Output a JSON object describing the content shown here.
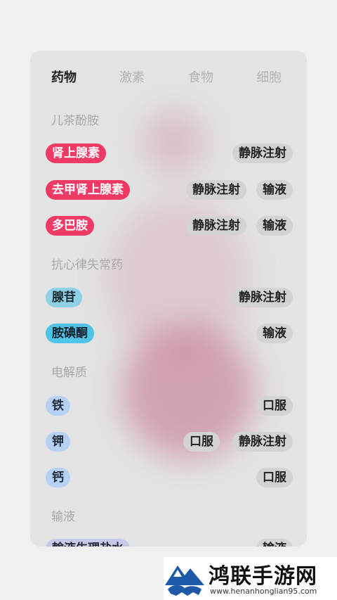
{
  "tabs": [
    "药物",
    "激素",
    "食物",
    "细胞"
  ],
  "sections": {
    "s1": "儿茶酚胺",
    "s2": "抗心律失常药",
    "s3": "电解质",
    "s4": "输液"
  },
  "rows": [
    {
      "name": "肾上腺素",
      "tags": [
        "静脉注射"
      ]
    },
    {
      "name": "去甲肾上腺素",
      "tags": [
        "静脉注射",
        "输液"
      ]
    },
    {
      "name": "多巴胺",
      "tags": [
        "静脉注射",
        "输液"
      ]
    },
    {
      "name": "腺苷",
      "tags": [
        "静脉注射"
      ]
    },
    {
      "name": "胺碘酮",
      "tags": [
        "输液"
      ]
    },
    {
      "name": "铁",
      "tags": [
        "口服"
      ]
    },
    {
      "name": "钾",
      "tags": [
        "口服",
        "静脉注射"
      ]
    },
    {
      "name": "钙",
      "tags": [
        "口服"
      ]
    },
    {
      "name": "輸液生理盐水",
      "tags": [
        "输液"
      ]
    }
  ],
  "colors": {
    "red_pill": "#ef3a66",
    "teal_pill": "#8fd0e5",
    "cyan_pill": "#4fc3e8",
    "blue_pill": "#b7d1f4",
    "tag_bg": "#d3d3d3",
    "card_bg": "#e3e3e3"
  },
  "watermark": {
    "title": "鸿联手游网",
    "url": "www.henanhonglian95.com"
  }
}
